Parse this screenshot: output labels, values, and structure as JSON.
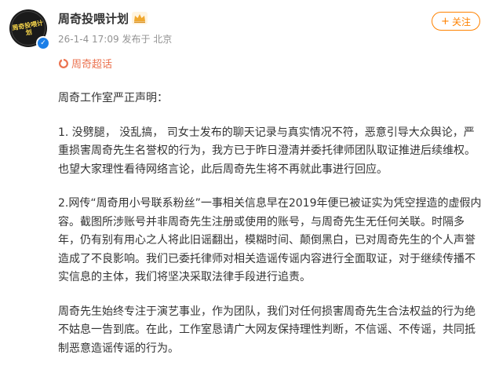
{
  "post": {
    "author": {
      "name": "周奇投喂计划",
      "avatar_text": "周奇投喂计划"
    },
    "time": "26-1-4 17:09",
    "source": "发布于 北京",
    "follow_label": "关注",
    "topic": "周奇超话",
    "paragraphs": [
      "周奇工作室严正声明：",
      "1. 没劈腿， 没乱搞， 司女士发布的聊天记录与真实情况不符，恶意引导大众舆论，严重损害周奇先生名誉权的行为，我方已于昨日澄清并委托律师团队取证推进后续维权。也望大家理性看待网络言论，此后周奇先生将不再就此事进行回应。",
      "2.网传“周奇用小号联系粉丝”一事相关信息早在2019年便已被证实为凭空捏造的虚假内容。截图所涉账号并非周奇先生注册或使用的账号，与周奇先生无任何关联。时隔多年，仍有别有用心之人将此旧谣翻出，模糊时间、颠倒黑白，已对周奇先生的个人声誉造成了不良影响。我们已委托律师对相关造谣传谣内容进行全面取证，对于继续传播不实信息的主体，我们将坚决采取法律手段进行追责。",
      "周奇先生始终专注于演艺事业，作为团队，我们对任何损害周奇先生合法权益的行为绝不姑息一告到底。在此，工作室恳请广大网友保持理性判断，不信谣、不传谣，共同抵制恶意造谣传谣的行为。"
    ],
    "colors": {
      "accent": "#ff8200",
      "topic": "#eb7350",
      "verified": "#1a7ee8",
      "meta": "#939393"
    }
  }
}
